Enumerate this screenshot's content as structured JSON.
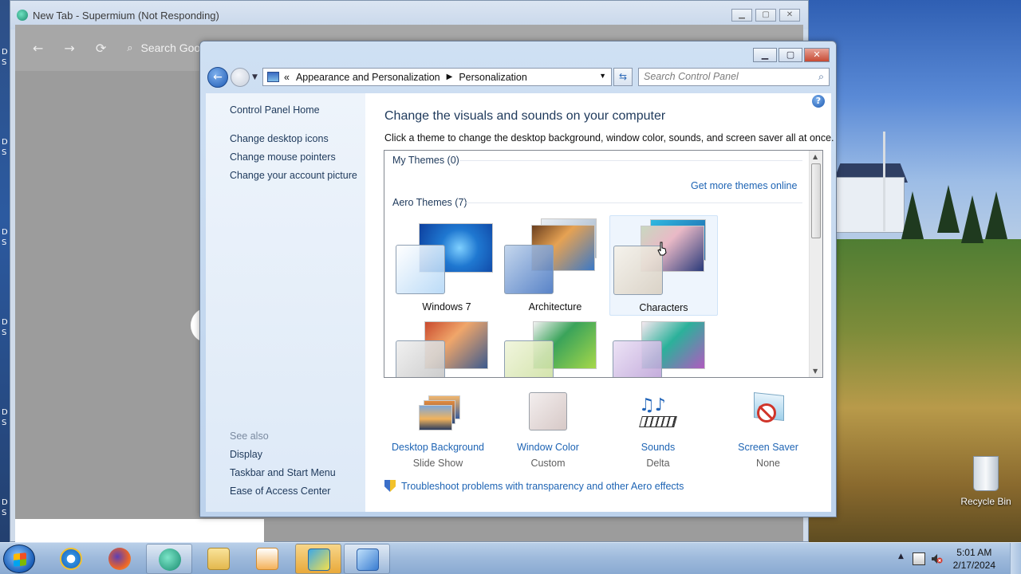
{
  "browser": {
    "title": "New Tab - Supermium (Not Responding)",
    "search_placeholder": "Search Goog",
    "title_buttons": [
      "minimize",
      "maximize",
      "close"
    ]
  },
  "desktop": {
    "side_letters": [
      "D",
      "S",
      "D",
      "S",
      "D",
      "S",
      "D",
      "S",
      "D",
      "S",
      "D",
      "S"
    ],
    "recycle_bin_label": "Recycle Bin"
  },
  "control_panel": {
    "address": {
      "prefix": "«",
      "crumb1": "Appearance and Personalization",
      "crumb2": "Personalization"
    },
    "search_placeholder": "Search Control Panel",
    "left_links": {
      "home": "Control Panel Home",
      "desktop_icons": "Change desktop icons",
      "mouse_pointers": "Change mouse pointers",
      "account_picture": "Change your account picture"
    },
    "see_also": {
      "heading": "See also",
      "display": "Display",
      "taskbar": "Taskbar and Start Menu",
      "ease": "Ease of Access Center"
    },
    "heading": "Change the visuals and sounds on your computer",
    "subheading": "Click a theme to change the desktop background, window color, sounds, and screen saver all at once.",
    "my_themes_label": "My Themes (0)",
    "get_more_link": "Get more themes online",
    "aero_themes_label": "Aero Themes (7)",
    "themes": [
      {
        "name": "Windows 7",
        "selected": false
      },
      {
        "name": "Architecture",
        "selected": false
      },
      {
        "name": "Characters",
        "selected": true
      }
    ],
    "bottom": {
      "background": {
        "title": "Desktop Background",
        "value": "Slide Show"
      },
      "color": {
        "title": "Window Color",
        "value": "Custom"
      },
      "sounds": {
        "title": "Sounds",
        "value": "Delta"
      },
      "saver": {
        "title": "Screen Saver",
        "value": "None"
      }
    },
    "troubleshoot_link": "Troubleshoot problems with transparency and other Aero effects"
  },
  "taskbar": {
    "time": "5:01 AM",
    "date": "2/17/2024"
  },
  "colors": {
    "link": "#1e64b4",
    "heading": "#1e395b",
    "accent_close": "#c74a33"
  }
}
